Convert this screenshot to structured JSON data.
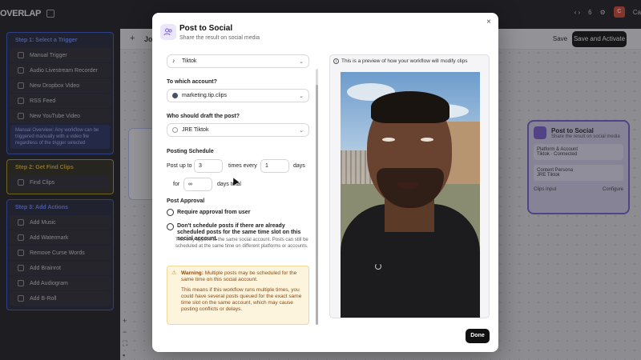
{
  "app": {
    "logo": "OVERLAP",
    "top_right_count": "6",
    "user_initial": "C",
    "user_name_partial": "Ca",
    "canvas_title": "Jo",
    "save_label": "Save",
    "activate_label": "Save and Activate"
  },
  "sidebar": {
    "step1_title": "Step 1: Select a Trigger",
    "step1_items": [
      "Manual Trigger",
      "Audio Livestream Recorder",
      "New Dropbox Video",
      "RSS Feed",
      "New YouTube Video"
    ],
    "step1_note": "Manual Overview: Any workflow can be triggered manually with a video file regardless of the trigger selected",
    "step2_title": "Step 2: Get Find Clips",
    "step2_items": [
      "Find Clips"
    ],
    "step3_title": "Step 3: Add Actions",
    "step3_items": [
      "Add Music",
      "Add Watermark",
      "Remove Curse Words",
      "Add Brainrot",
      "Add Audiogram",
      "Add B-Roll"
    ]
  },
  "bg_node": {
    "title": "Post to Social",
    "subtitle": "Share the result on social media",
    "platform_label": "Platform & Account",
    "platform_value": "Tiktok",
    "status": "Connected",
    "persona_label": "Content Persona",
    "persona_value": "JRE Tiktok",
    "foot_left": "Clips Input",
    "foot_right": "Configure"
  },
  "modal": {
    "title": "Post to Social",
    "subtitle": "Share the result on social media",
    "close": "×",
    "platform_select": "Tiktok",
    "account_label": "To which account?",
    "account_select": "marketing.tip.clips",
    "draft_label": "Who should draft the post?",
    "draft_select": "JRE Tiktok",
    "schedule_label": "Posting Schedule",
    "post_up_to": "Post up to",
    "posts_value": "3",
    "times_every": "times every",
    "days_value": "1",
    "days": "days",
    "for_text": "for",
    "total_value": "∞",
    "days_total": "days total",
    "approval_label": "Post Approval",
    "require_approval": "Require approval from user",
    "dont_schedule": "Don't schedule posts if there are already scheduled posts for the same time slot on this social account.",
    "help_text": "This only applies to the same social account. Posts can still be scheduled at the same time on different platforms or accounts.",
    "warning_title": "Warning:",
    "warning_line1": "Multiple posts may be scheduled for the same time on this social account.",
    "warning_line2": "This means if this workflow runs multiple times, you could have several posts queued for the exact same time slot on the same account, which may cause posting conflicts or delays.",
    "preview_note": "This is a preview of how your workflow will modify clips",
    "done_label": "Done"
  }
}
